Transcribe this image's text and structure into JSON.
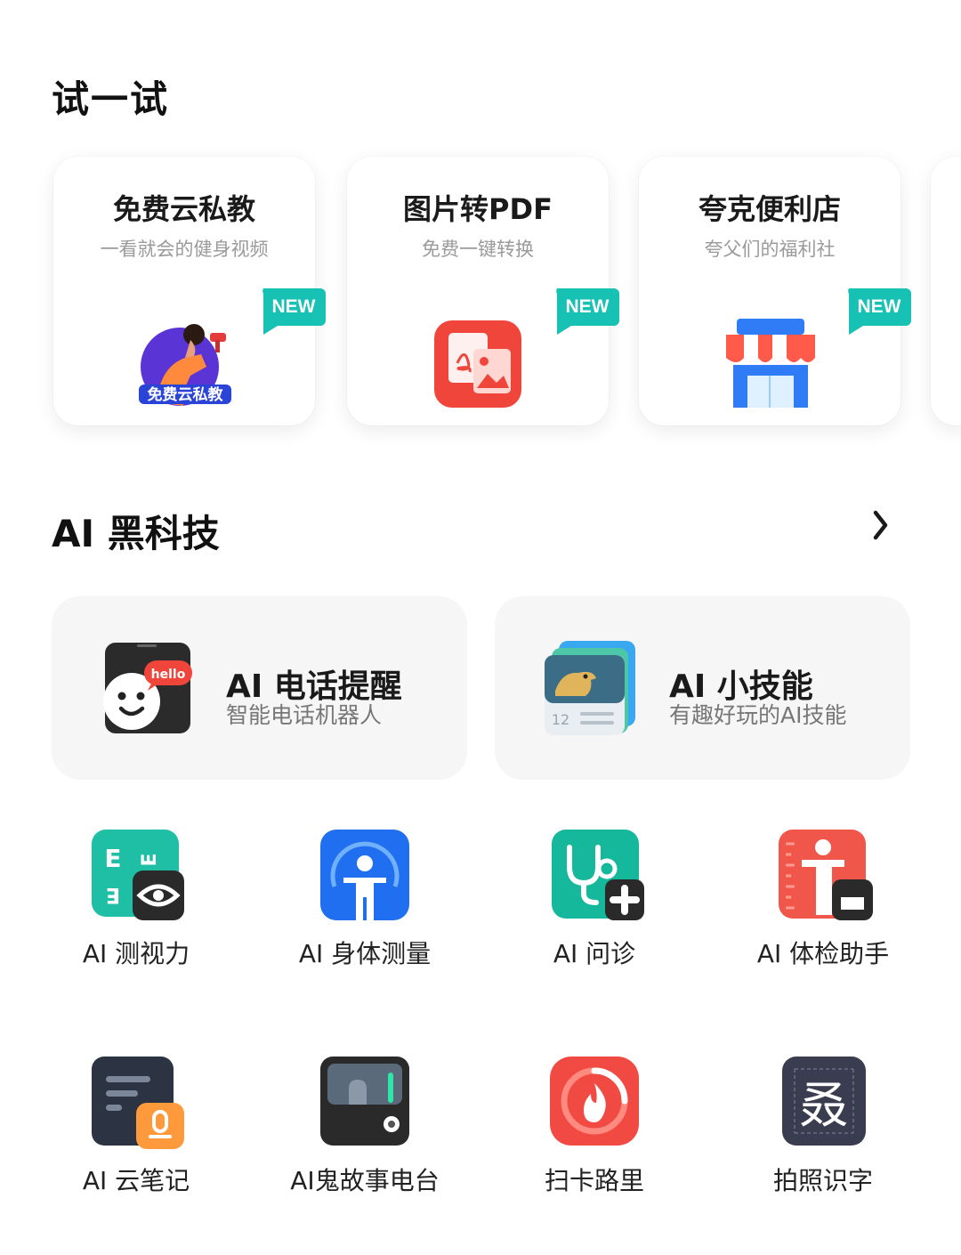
{
  "try_section": {
    "title": "试一试",
    "badge_label": "NEW",
    "cards": [
      {
        "title": "免费云私教",
        "subtitle": "一看就会的健身视频",
        "icon": "fitness-trainer-icon",
        "icon_text": "免费云私教"
      },
      {
        "title": "图片转PDF",
        "subtitle": "免费一键转换",
        "icon": "image-to-pdf-icon"
      },
      {
        "title": "夸克便利店",
        "subtitle": "夸父们的福利社",
        "icon": "store-front-icon"
      }
    ]
  },
  "ai_section": {
    "title": "AI 黑科技",
    "more_icon": "chevron-right-icon",
    "features": [
      {
        "title": "AI 电话提醒",
        "subtitle": "智能电话机器人",
        "icon": "phone-robot-icon",
        "icon_text": "hello"
      },
      {
        "title": "AI 小技能",
        "subtitle": "有趣好玩的AI技能",
        "icon": "ai-skills-stack-icon",
        "icon_text": "12"
      }
    ],
    "apps_row1": [
      {
        "label": "AI 测视力",
        "icon": "eye-test-icon"
      },
      {
        "label": "AI 身体测量",
        "icon": "body-measure-icon"
      },
      {
        "label": "AI 问诊",
        "icon": "stethoscope-icon"
      },
      {
        "label": "AI 体检助手",
        "icon": "health-check-icon"
      }
    ],
    "apps_row2": [
      {
        "label": "AI 云笔记",
        "icon": "cloud-notes-icon"
      },
      {
        "label": "AI鬼故事电台",
        "icon": "ghost-radio-icon"
      },
      {
        "label": "扫卡路里",
        "icon": "calorie-flame-icon"
      },
      {
        "label": "拍照识字",
        "icon": "photo-ocr-icon",
        "icon_text": "叒"
      }
    ]
  },
  "colors": {
    "badge_teal": "#17c1b4",
    "card_red": "#f0453a",
    "store_blue": "#2f7cf6",
    "feature_bg": "#f6f6f6"
  }
}
